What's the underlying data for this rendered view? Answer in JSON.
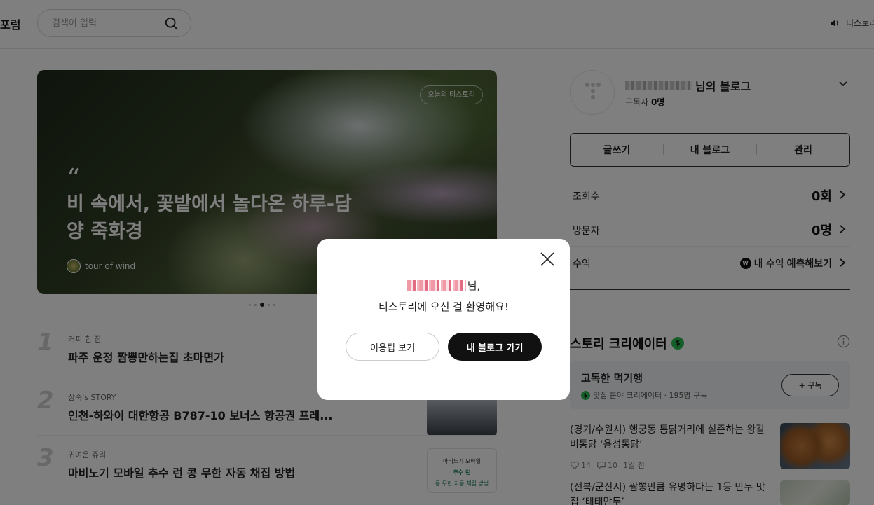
{
  "header": {
    "logo_text": "포럼",
    "search_placeholder": "검색어 입력",
    "notice_text": "티스토리"
  },
  "hero": {
    "badge": "오늘의 티스토리",
    "quote_mark": "“",
    "title": "비 속에서, 꽃밭에서 놀다온 하루-담양 죽화경",
    "author": "tour of wind"
  },
  "rankings": [
    {
      "num": "1",
      "category": "커피 한 잔",
      "title": "파주 운정 짬뽕만하는집 초마면가"
    },
    {
      "num": "2",
      "category": "삼숙's STORY",
      "title": "인천-하와이 대한항공 B787-10 보너스 항공권 프레..."
    },
    {
      "num": "3",
      "category": "귀여운 쥬리",
      "title": "마비노기 모바일 추수 런 콩 무한 자동 채집 방법"
    }
  ],
  "rank3_thumb": {
    "line1": "마비노기 모바일",
    "line2": "추수 런",
    "line3": "콩 무한 자동 채집 방법"
  },
  "profile": {
    "blog_suffix": "님의 블로그",
    "subscribers_label": "구독자",
    "subscribers_count": "0명"
  },
  "buttons": {
    "write": "글쓰기",
    "my_blog": "내 블로그",
    "manage": "관리"
  },
  "stats": {
    "views_label": "조회수",
    "views_value": "0회",
    "visitors_label": "방문자",
    "visitors_value": "0명",
    "revenue_label": "수익",
    "revenue_prefix": "내 수익",
    "revenue_action": "예측해보기"
  },
  "creator": {
    "heading": "스토리 크리에이터",
    "card_name": "고독한 먹기행",
    "card_meta": "맛집 분야 크리에이터 · 195명 구독",
    "subscribe_label": "+ 구독"
  },
  "posts": [
    {
      "title": "(경기/수원시) 행궁동 통닭거리에 실존하는 왕갈비통닭 ‘용성통닭’",
      "likes": "14",
      "comments": "10",
      "time": "1일 전"
    },
    {
      "title": "(전북/군산시) 짬뽕만큼 유명하다는 1등 만두 맛집 ‘태태만두’"
    }
  ],
  "modal": {
    "name_suffix": "님,",
    "message": "티스토리에 오신 걸 환영해요!",
    "tips_button": "이용팁 보기",
    "go_blog_button": "내 블로그 가기"
  }
}
